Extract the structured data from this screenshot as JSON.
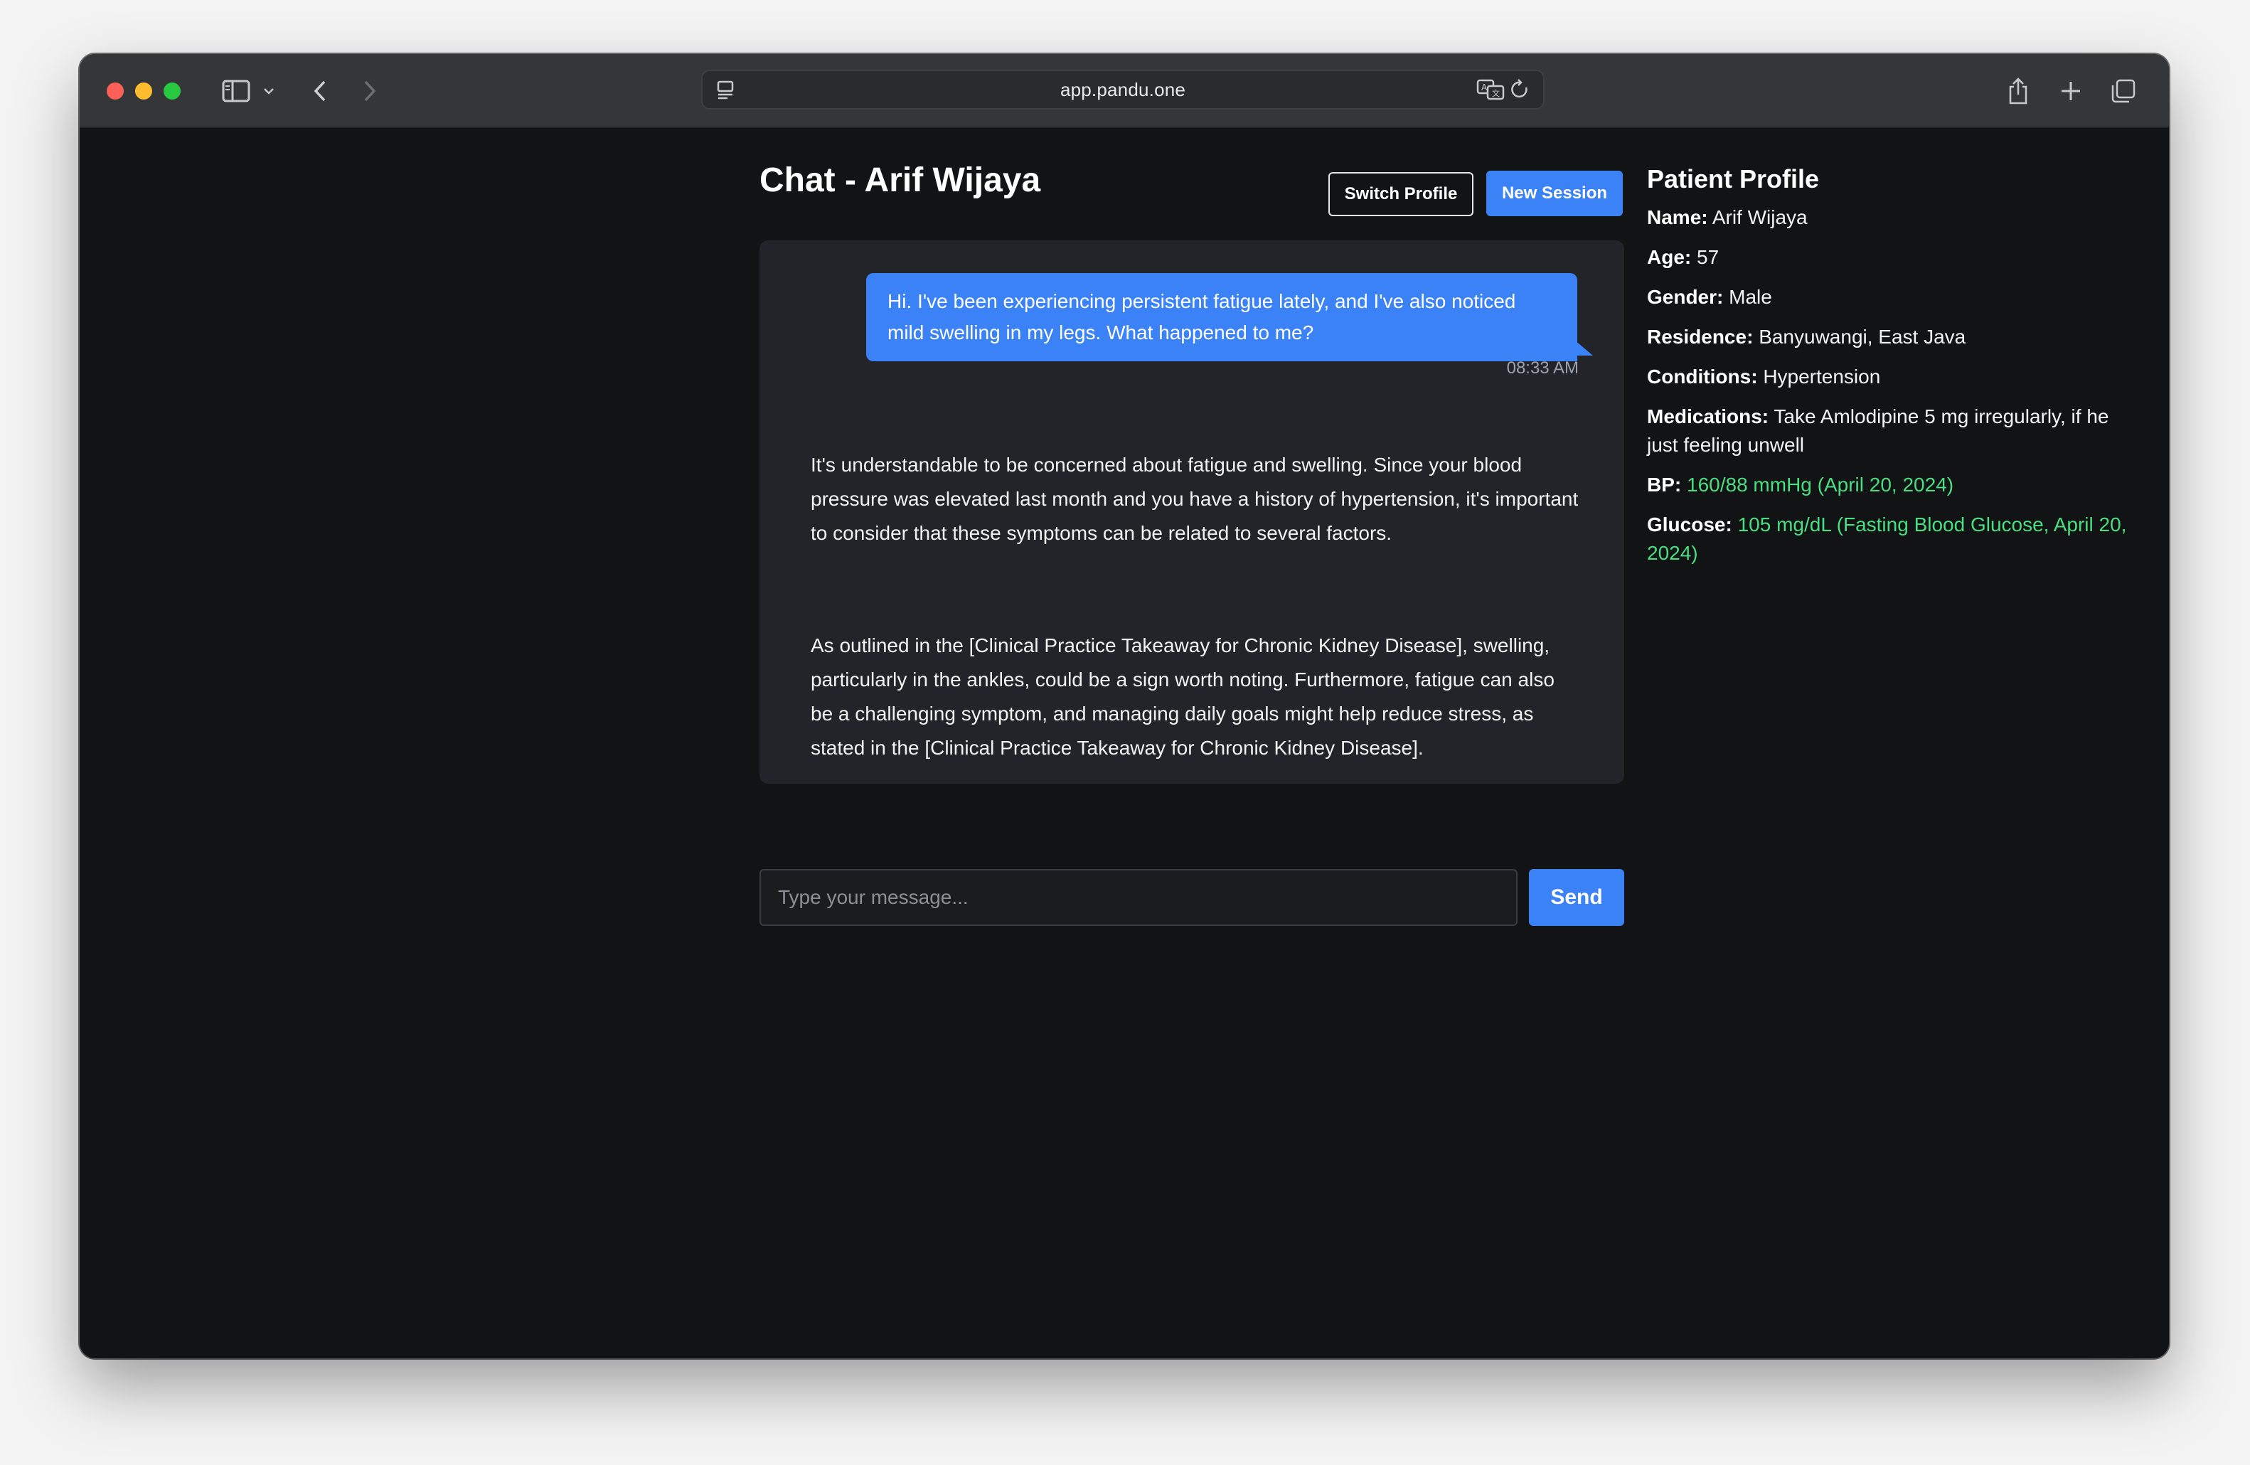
{
  "browser": {
    "url": "app.pandu.one"
  },
  "chat": {
    "title": "Chat - Arif Wijaya",
    "switch_profile_label": "Switch Profile",
    "new_session_label": "New Session",
    "messages": [
      {
        "role": "user",
        "text": "Hi. I've been experiencing persistent fatigue lately, and I've also noticed mild swelling in my legs. What happened to me?",
        "time": "08:33 AM"
      },
      {
        "role": "assistant",
        "paragraphs": [
          "It's understandable to be concerned about fatigue and swelling. Since your blood pressure was elevated last month and you have a history of hypertension, it's important to consider that these symptoms can be related to several factors.",
          "As outlined in the [Clinical Practice Takeaway for Chronic Kidney Disease], swelling, particularly in the ankles, could be a sign worth noting. Furthermore, fatigue can also be a challenging symptom, and managing daily goals might help reduce stress, as stated in the [Clinical Practice Takeaway for Chronic Kidney Disease]."
        ]
      }
    ],
    "input_placeholder": "Type your message...",
    "send_label": "Send"
  },
  "profile": {
    "title": "Patient Profile",
    "fields": [
      {
        "label": "Name:",
        "value": "Arif Wijaya"
      },
      {
        "label": "Age:",
        "value": "57"
      },
      {
        "label": "Gender:",
        "value": "Male"
      },
      {
        "label": "Residence:",
        "value": "Banyuwangi, East Java"
      },
      {
        "label": "Conditions:",
        "value": "Hypertension"
      },
      {
        "label": "Medications:",
        "value": "Take Amlodipine 5 mg irregularly, if he just feeling unwell"
      },
      {
        "label": "BP:",
        "value": "160/88 mmHg (April 20, 2024)"
      },
      {
        "label": "Glucose:",
        "value": "105 mg/dL (Fasting Blood Glucose, April 20, 2024)"
      }
    ]
  },
  "colors": {
    "accent": "#3b82f6",
    "vitals_green": "#4ade80",
    "background": "#121315",
    "panel": "#222429"
  },
  "icons": [
    "close-dot",
    "minimize-dot",
    "zoom-dot",
    "sidebar-icon",
    "chevron-down-icon",
    "back-icon",
    "forward-icon",
    "page-icon",
    "translate-icon",
    "reload-icon",
    "share-icon",
    "new-tab-icon",
    "tabs-overview-icon"
  ]
}
